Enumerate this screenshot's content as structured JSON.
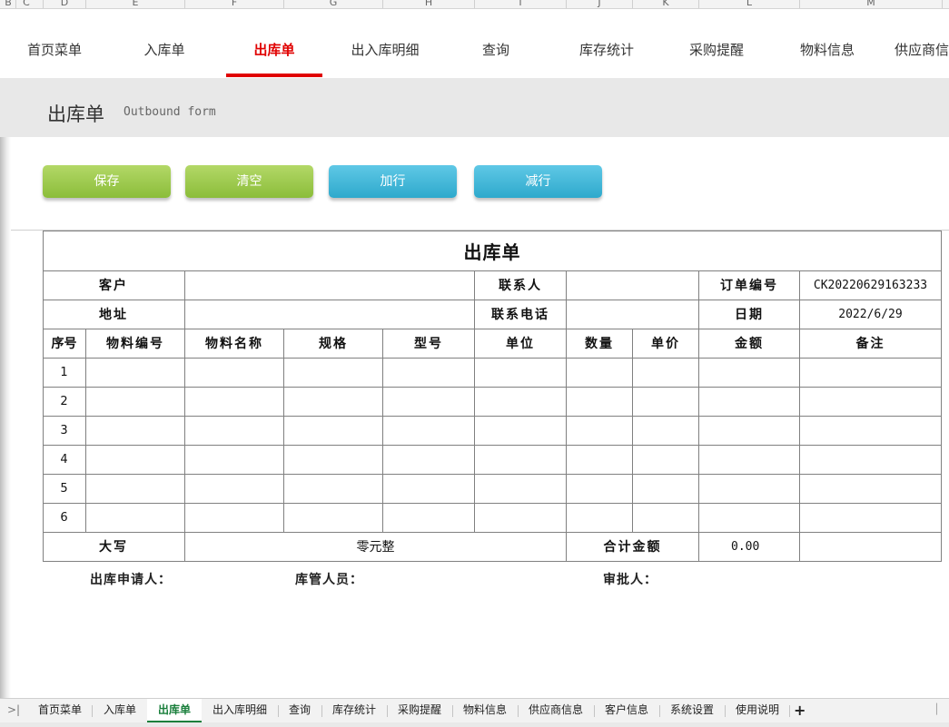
{
  "columns": [
    "B",
    "C",
    "D",
    "E",
    "F",
    "G",
    "H",
    "I",
    "J",
    "K",
    "L",
    "M"
  ],
  "nav": {
    "items": [
      {
        "label": "首页菜单"
      },
      {
        "label": "入库单"
      },
      {
        "label": "出库单",
        "active": true
      },
      {
        "label": "出入库明细"
      },
      {
        "label": "查询"
      },
      {
        "label": "库存统计"
      },
      {
        "label": "采购提醒"
      },
      {
        "label": "物料信息"
      },
      {
        "label": "供应商信"
      }
    ]
  },
  "header": {
    "title": "出库单",
    "subtitle": "Outbound form"
  },
  "toolbar": {
    "save": "保存",
    "clear": "清空",
    "add_row": "加行",
    "remove_row": "减行"
  },
  "colors": {
    "active_tab": "#e00000",
    "green_button": "#9ccb4d",
    "blue_button": "#3db6d8",
    "sheet_active": "#1a7f3c"
  },
  "form": {
    "title": "出库单",
    "customer_label": "客户",
    "customer_value": "",
    "contact_label": "联系人",
    "contact_value": "",
    "order_no_label": "订单编号",
    "order_no_value": "CK20220629163233",
    "address_label": "地址",
    "address_value": "",
    "phone_label": "联系电话",
    "phone_value": "",
    "date_label": "日期",
    "date_value": "2022/6/29",
    "columns": [
      "序号",
      "物料编号",
      "物料名称",
      "规格",
      "型号",
      "单位",
      "数量",
      "单价",
      "金额",
      "备注"
    ],
    "rows": [
      {
        "no": "1"
      },
      {
        "no": "2"
      },
      {
        "no": "3"
      },
      {
        "no": "4"
      },
      {
        "no": "5"
      },
      {
        "no": "6"
      }
    ],
    "capital_label": "大写",
    "capital_value": "零元整",
    "total_label": "合计金额",
    "total_value": "0.00"
  },
  "signatures": {
    "applicant": "出库申请人：",
    "keeper": "库管人员：",
    "approver": "审批人："
  },
  "sheets": {
    "tabs": [
      {
        "label": "首页菜单"
      },
      {
        "label": "入库单"
      },
      {
        "label": "出库单",
        "active": true
      },
      {
        "label": "出入库明细"
      },
      {
        "label": "查询"
      },
      {
        "label": "库存统计"
      },
      {
        "label": "采购提醒"
      },
      {
        "label": "物料信息"
      },
      {
        "label": "供应商信息"
      },
      {
        "label": "客户信息"
      },
      {
        "label": "系统设置"
      },
      {
        "label": "使用说明"
      }
    ],
    "add_label": "+"
  }
}
